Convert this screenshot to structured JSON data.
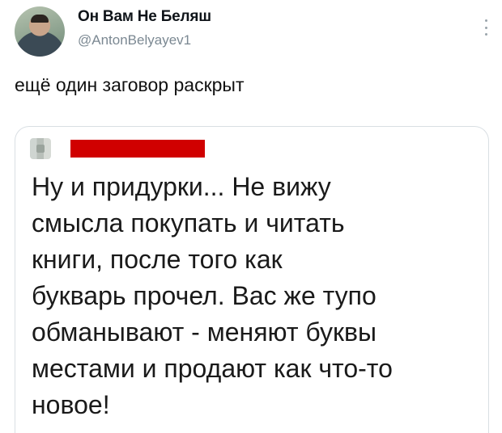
{
  "tweet": {
    "author_name": "Он Вам Не Беляш",
    "author_handle": "@AntonBelyayev1",
    "text": "ещё один заговор раскрыт"
  },
  "quoted_tweet": {
    "lines": [
      "Ну и придурки... Не вижу",
      "смысла покупать и читать",
      "книги, после того как",
      "букварь прочел. Вас же тупо",
      "обманывают - меняют буквы",
      "местами и продают как что-то",
      "новое!"
    ],
    "redaction_color": "#d00000"
  },
  "icons": {
    "more": "more-options-icon"
  }
}
